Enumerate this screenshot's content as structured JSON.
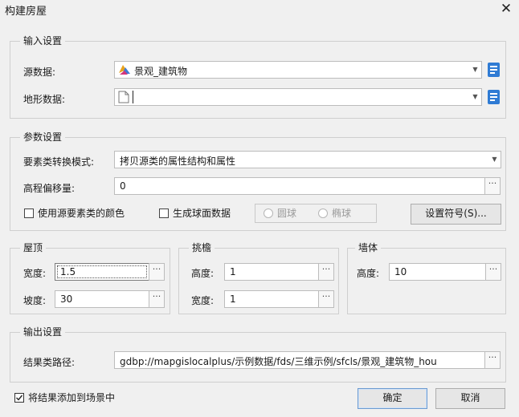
{
  "window": {
    "title": "构建房屋",
    "close_glyph": "✕"
  },
  "input_settings": {
    "legend": "输入设置",
    "source_label": "源数据:",
    "source_value": "景观_建筑物",
    "terrain_label": "地形数据:",
    "terrain_value": ""
  },
  "param_settings": {
    "legend": "参数设置",
    "mode_label": "要素类转换模式:",
    "mode_value": "拷贝源类的属性结构和属性",
    "elev_label": "高程偏移量:",
    "elev_value": "0",
    "use_color_label": "使用源要素类的颜色",
    "gen_sphere_label": "生成球面数据",
    "sphere_label": "圆球",
    "ellipsoid_label": "椭球",
    "symbol_button": "设置符号(S)..."
  },
  "roof": {
    "legend": "屋顶",
    "width_label": "宽度:",
    "width_value": "1.5",
    "slope_label": "坡度:",
    "slope_value": "30"
  },
  "eaves": {
    "legend": "挑檐",
    "height_label": "高度:",
    "height_value": "1",
    "width_label": "宽度:",
    "width_value": "1"
  },
  "wall": {
    "legend": "墙体",
    "height_label": "高度:",
    "height_value": "10"
  },
  "output_settings": {
    "legend": "输出设置",
    "path_label": "结果类路径:",
    "path_value": "gdbp://mapgislocalplus/示例数据/fds/三维示例/sfcls/景观_建筑物_hou"
  },
  "footer": {
    "add_to_scene_label": "将结果添加到场景中",
    "ok_button": "确定",
    "cancel_button": "取消"
  },
  "common": {
    "ellipsis": "···",
    "dropdown_arrow": "▼"
  },
  "colors": {
    "accent": "#2a6fc9",
    "background": "#f0f0f0"
  }
}
